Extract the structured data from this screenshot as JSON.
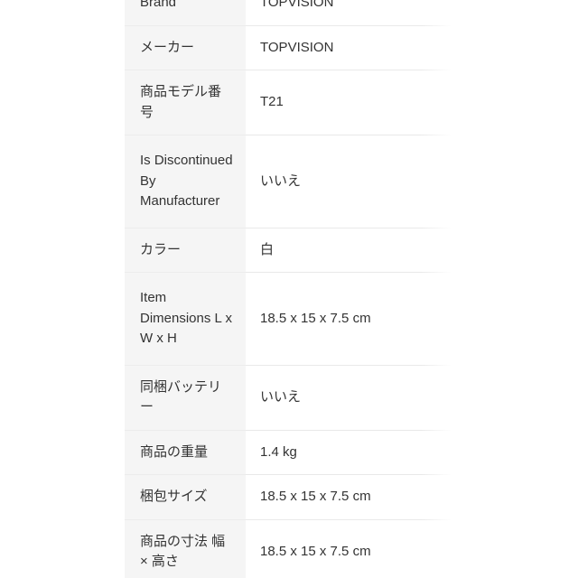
{
  "page": {
    "background_color": "#ffffff",
    "text_color": "#333333",
    "label_cell_background": "#f5f5f5",
    "value_cell_background": "#ffffff",
    "divider_color": "#e9e9e9"
  },
  "spec_table": {
    "rows": [
      {
        "label": "Brand",
        "value": "TOPVISION"
      },
      {
        "label": "メーカー",
        "value": "TOPVISION"
      },
      {
        "label": "商品モデル番号",
        "value": "T21"
      },
      {
        "label": "Is Discontinued By Manufacturer",
        "value": "いいえ"
      },
      {
        "label": "カラー",
        "value": "白"
      },
      {
        "label": "Item Dimensions L x W x H",
        "value": "18.5 x 15 x 7.5 cm"
      },
      {
        "label": "同梱バッテリー",
        "value": "いいえ"
      },
      {
        "label": "商品の重量",
        "value": "1.4 kg"
      },
      {
        "label": "梱包サイズ",
        "value": "18.5 x 15 x 7.5 cm"
      },
      {
        "label": "商品の寸法 幅 × 高さ",
        "value": "18.5 x 15 x 7.5 cm"
      }
    ]
  }
}
